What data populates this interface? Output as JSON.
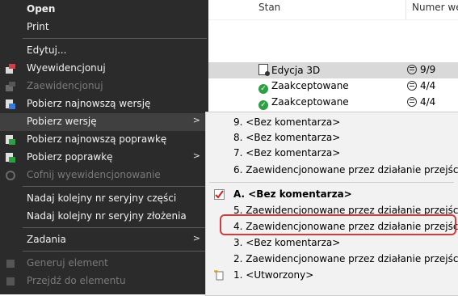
{
  "list": {
    "columns": [
      "Stan",
      "Numer wer"
    ],
    "rows": [
      {
        "state": "Edycja 3D",
        "version": "9/9",
        "state_icon": "edit-document-icon"
      },
      {
        "state": "Zaakceptowane",
        "version": "4/4",
        "state_icon": "check-circle-icon"
      },
      {
        "state": "Zaakceptowane",
        "version": "4/4",
        "state_icon": "check-circle-icon"
      }
    ]
  },
  "menu": {
    "items": [
      {
        "label": "Open"
      },
      {
        "label": "Print"
      },
      {
        "label": "Edytuj..."
      },
      {
        "label": "Wyewidencjonuj",
        "icon": "checkout-icon"
      },
      {
        "label": "Zaewidencjonuj",
        "icon": "checkin-icon"
      },
      {
        "label": "Pobierz najnowszą wersję",
        "icon": "get-latest-icon"
      },
      {
        "label": "Pobierz wersję"
      },
      {
        "label": "Pobierz najnowszą poprawkę",
        "icon": "get-latest-revision-icon"
      },
      {
        "label": "Pobierz poprawkę",
        "icon": "get-revision-icon"
      },
      {
        "label": "Cofnij wyewidencjonowanie",
        "icon": "undo-checkout-icon"
      },
      {
        "label": "Nadaj kolejny nr seryjny części"
      },
      {
        "label": "Nadaj kolejny nr seryjny złożenia"
      },
      {
        "label": "Zadania"
      },
      {
        "label": "Generuj element",
        "icon": "generate-icon"
      },
      {
        "label": "Przejdź do elementu",
        "icon": "goto-icon"
      }
    ]
  },
  "submenu": {
    "items": [
      {
        "label": "9. <Bez komentarza>"
      },
      {
        "label": "8. <Bez komentarza>"
      },
      {
        "label": "7. <Bez komentarza>"
      },
      {
        "label": "6. Zaewidencjonowane przez działanie przejścia"
      },
      {
        "label": "A. <Bez komentarza>",
        "icon": "checked-version-icon"
      },
      {
        "label": "5. Zaewidencjonowane przez działanie przejścia"
      },
      {
        "label": "4. Zaewidencjonowane przez działanie przejścia"
      },
      {
        "label": "3. <Bez komentarza>"
      },
      {
        "label": "2. Zaewidencjonowane przez działanie przejścia"
      },
      {
        "label": "1. <Utworzony>",
        "icon": "new-document-icon"
      }
    ]
  },
  "colors": {
    "menu_bg": "#2b2b2b",
    "menu_hover": "#404040",
    "submenu_bg": "#f2f2f2",
    "highlight": "#d43b3b"
  }
}
